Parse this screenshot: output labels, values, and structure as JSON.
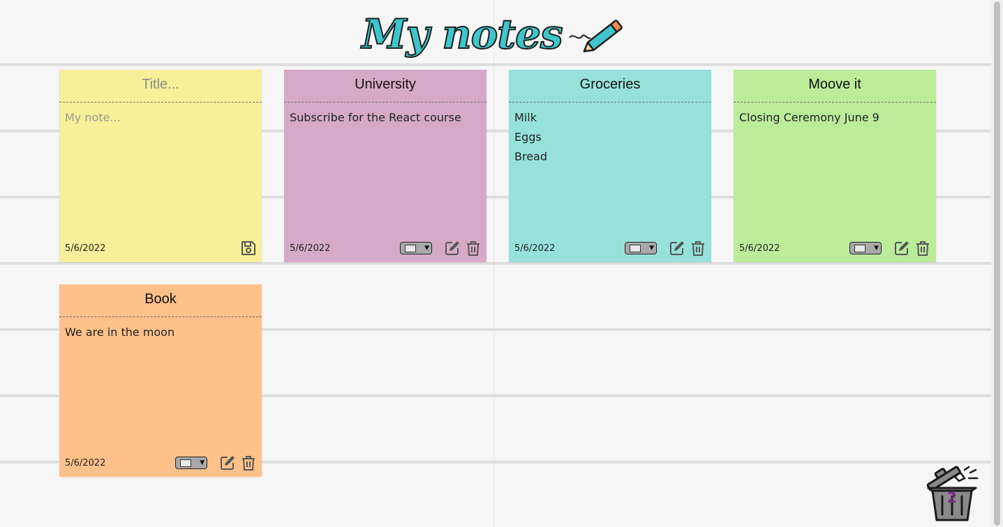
{
  "header": {
    "title": "My notes"
  },
  "notes": [
    {
      "title": "Title...",
      "body": [
        "My note..."
      ],
      "date": "5/6/2022",
      "color": "#f7ef9a",
      "placeholder": true
    },
    {
      "title": "University",
      "body": [
        "Subscribe for the React course"
      ],
      "date": "5/6/2022",
      "color": "#d7a9c8",
      "placeholder": false
    },
    {
      "title": "Groceries",
      "body": [
        "Milk",
        "Eggs",
        "Bread"
      ],
      "date": "5/6/2022",
      "color": "#96e2db",
      "placeholder": false
    },
    {
      "title": "Moove it",
      "body": [
        "Closing Ceremony June 9"
      ],
      "date": "5/6/2022",
      "color": "#bbec9a",
      "placeholder": false
    },
    {
      "title": "Book",
      "body": [
        "We are in the moon"
      ],
      "date": "5/6/2022",
      "color": "#ffc18a",
      "placeholder": false
    }
  ],
  "icons": {
    "save": "floppy-disk-icon",
    "edit": "edit-icon",
    "delete": "trash-icon",
    "bin": "trash-bin-icon"
  },
  "trash": {
    "count": "2"
  },
  "colors": {
    "title_fill": "#3ec6cc",
    "title_stroke": "#1e1e1e",
    "count": "#7b2a8c"
  }
}
